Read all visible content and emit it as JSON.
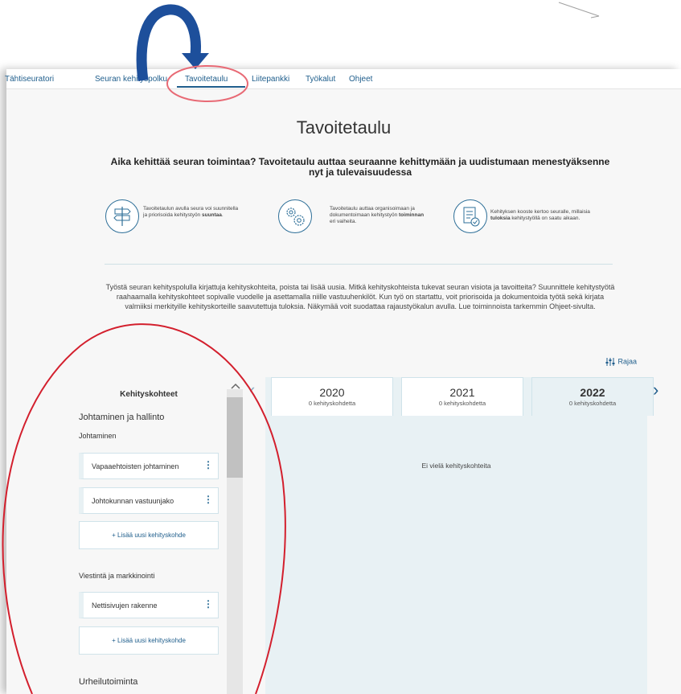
{
  "nav": {
    "items": [
      {
        "label": "Tähtiseuratori"
      },
      {
        "label": "Seuran kehityspolku"
      },
      {
        "label": "Tavoitetaulu"
      },
      {
        "label": "Liitepankki"
      },
      {
        "label": "Työkalut"
      },
      {
        "label": "Ohjeet"
      }
    ],
    "active": "Tavoitetaulu"
  },
  "page": {
    "title": "Tavoitetaulu",
    "subtitle": "Aika kehittää seuran toimintaa? Tavoitetaulu auttaa seuraanne kehittymään ja uudistumaan menestyäksenne nyt ja tulevaisuudessa",
    "features": [
      {
        "icon": "signpost-icon",
        "pre": "Tavoitetaulun avulla seura voi suunnitella ja priorisoida kehitystyön ",
        "bold": "suuntaa",
        "post": "."
      },
      {
        "icon": "gears-icon",
        "pre": "Tavoitetaulu auttaa organisoimaan ja dokumentoimaan kehitystyön ",
        "bold": "toiminnan",
        "post": " eri vaiheita."
      },
      {
        "icon": "checklist-icon",
        "pre": "Kehityksen kooste kertoo seuralle, millaisia ",
        "bold": "tuloksia",
        "post": " kehitystyöllä on saatu aikaan."
      }
    ],
    "intro": "Työstä seuran kehityspolulla kirjattuja kehityskohteita, poista tai lisää uusia. Mitkä kehityskohteista tukevat seuran visiota ja tavoitteita? Suunnittele kehitystyötä raahaamalla kehityskohteet sopivalle vuodelle ja asettamalla niille vastuuhenkilöt. Kun työ on startattu, voit priorisoida ja dokumentoida työtä sekä kirjata valmiiksi merkityille kehityskorteille saavutettuja tuloksia. Näkymää voit suodattaa rajaustyökalun avulla. Lue toiminnoista tarkemmin Ohjeet-sivulta.",
    "filter_label": "Rajaa"
  },
  "sidebar": {
    "title": "Kehityskohteet",
    "categories": [
      {
        "label": "Johtaminen ja hallinto"
      },
      {
        "label": "Viestintä ja markkinointi"
      },
      {
        "label": "Urheilutoiminta"
      }
    ],
    "subcategory": "Johtaminen",
    "items": [
      {
        "label": "Vapaaehtoisten johtaminen"
      },
      {
        "label": "Johtokunnan vastuunjako"
      },
      {
        "label": "Nettisivujen rakenne"
      }
    ],
    "add_label": "+ Lisää uusi kehityskohde"
  },
  "board": {
    "tabs": [
      {
        "year": "2020",
        "count": "0 kehityskohdetta"
      },
      {
        "year": "2021",
        "count": "0 kehityskohdetta"
      },
      {
        "year": "2022",
        "count": "0 kehityskohdetta"
      }
    ],
    "active_year": "2022",
    "empty_text": "Ei vielä kehityskohteita"
  },
  "colors": {
    "accent": "#1f5e8c",
    "annotation_red": "#d31f2d",
    "annotation_arrow": "#1d4f9b",
    "board_bg": "#e8f1f4"
  }
}
